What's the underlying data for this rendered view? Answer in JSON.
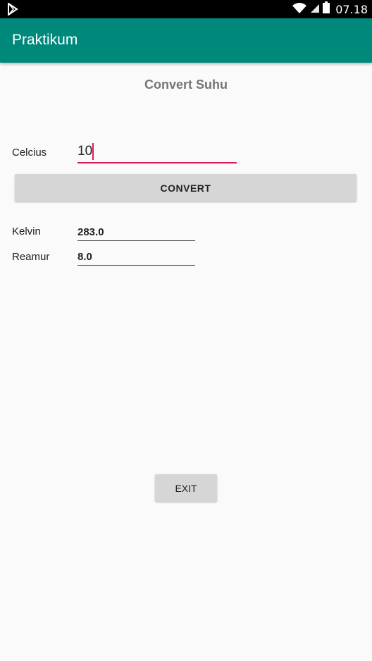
{
  "status_bar": {
    "time": "07.18",
    "left_icon": "play-store-notification-icon",
    "right_icons": [
      "wifi-icon",
      "signal-icon",
      "battery-icon"
    ]
  },
  "app_bar": {
    "title": "Praktikum",
    "color": "#00897b"
  },
  "main": {
    "heading": "Convert Suhu",
    "celcius": {
      "label": "Celcius",
      "value": "10",
      "accent_color": "#d81b60"
    },
    "convert_button": "CONVERT",
    "results": [
      {
        "label": "Kelvin",
        "value": "283.0"
      },
      {
        "label": "Reamur",
        "value": "8.0"
      }
    ],
    "exit_button": "EXIT"
  }
}
